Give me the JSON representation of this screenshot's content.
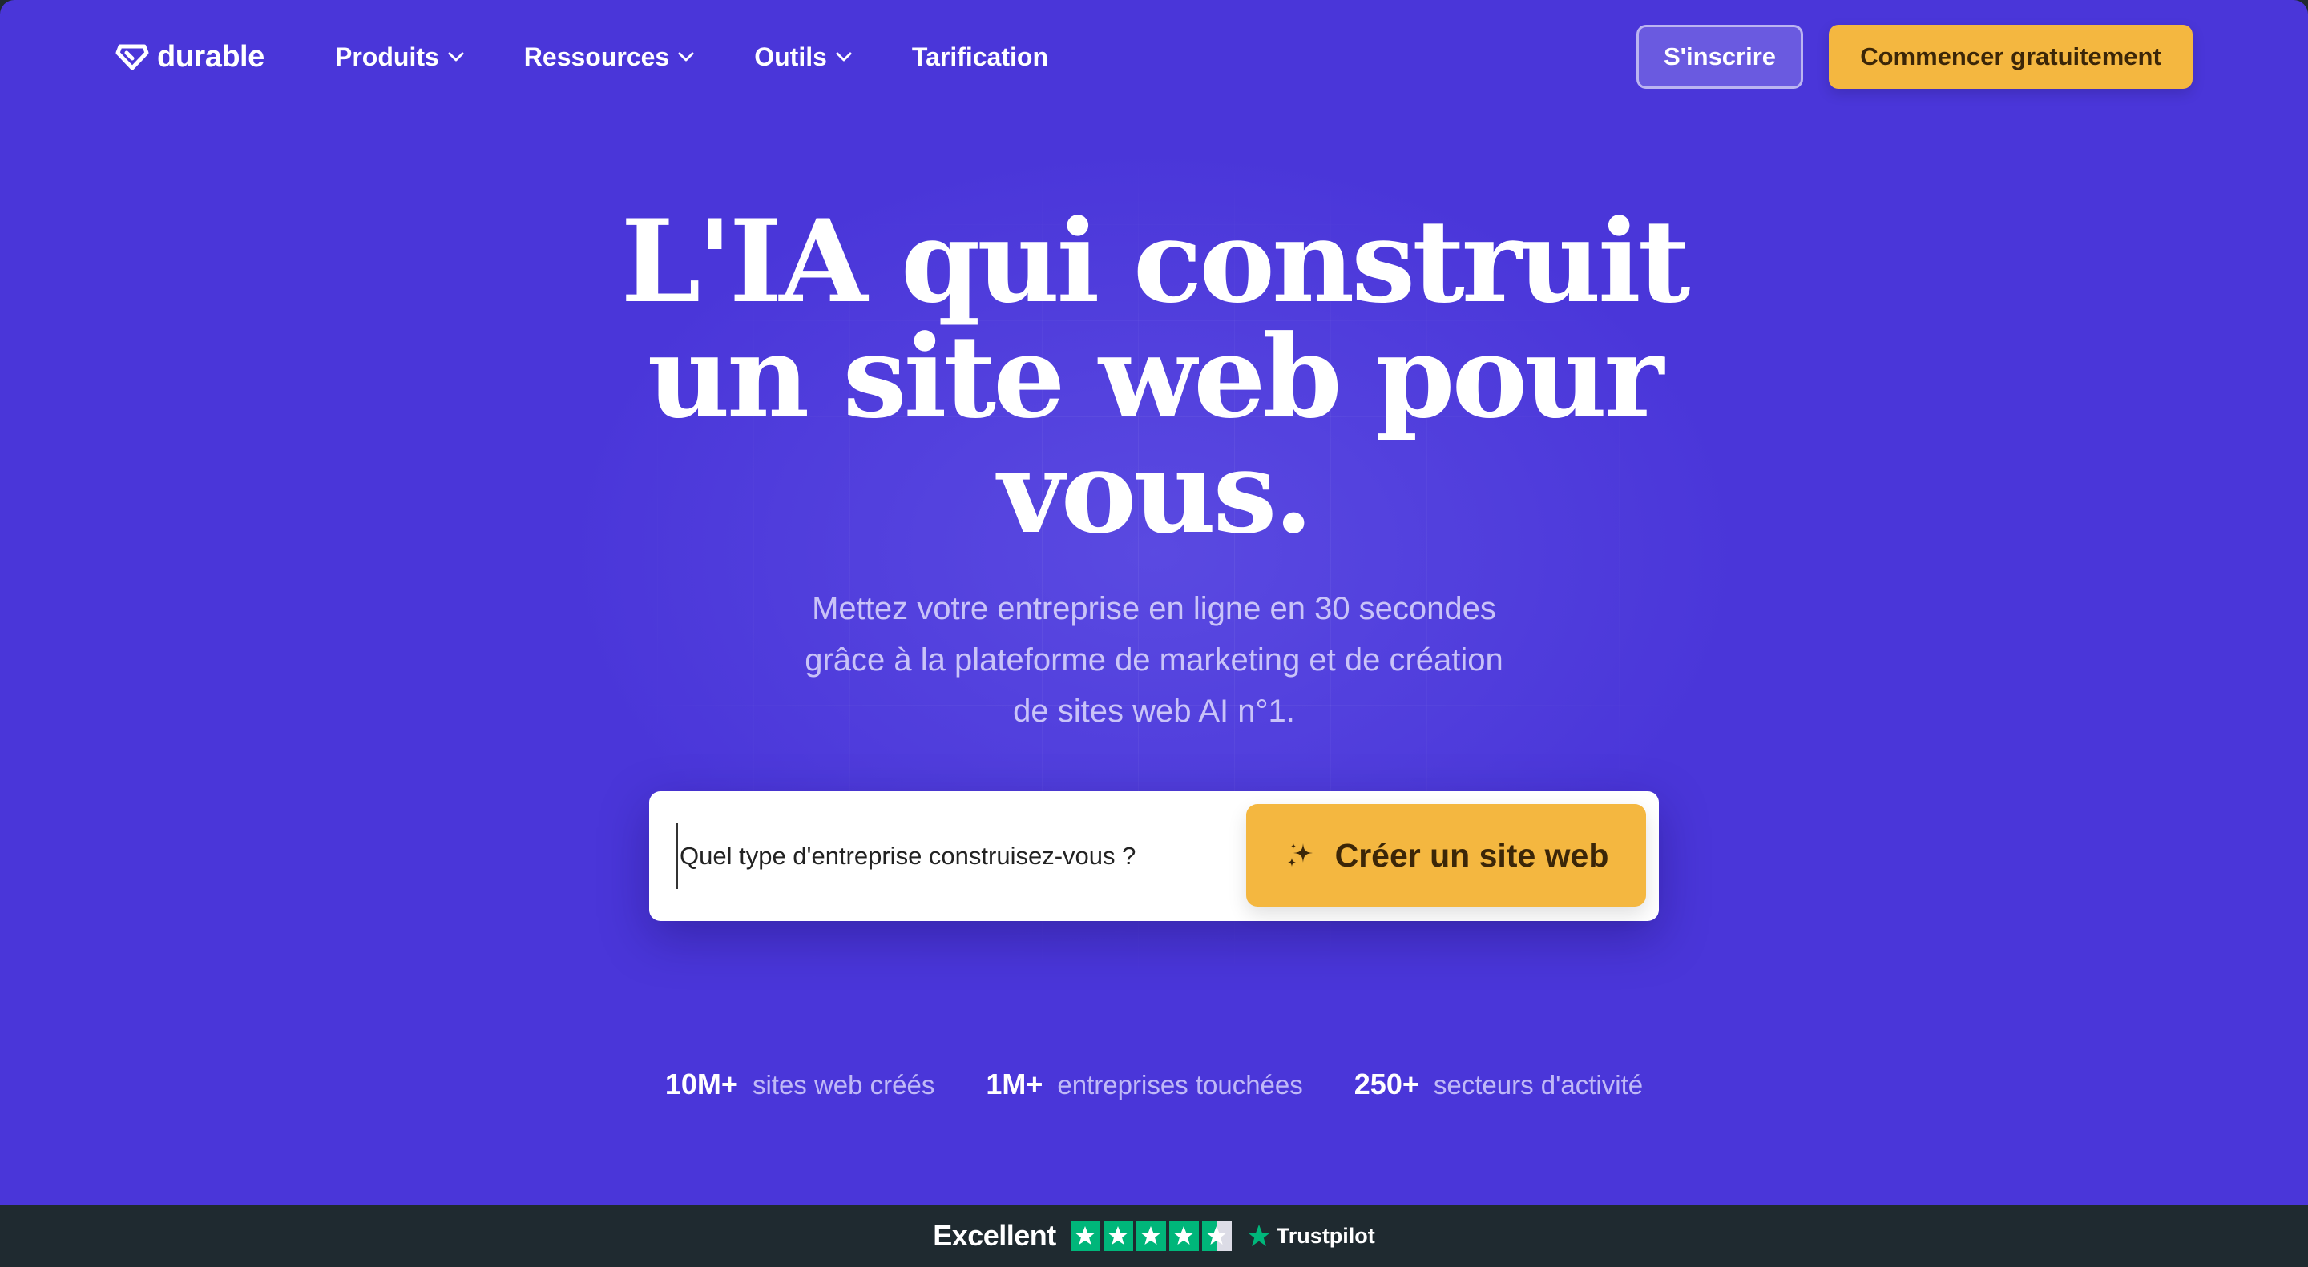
{
  "nav": {
    "logo_text": "durable",
    "items": [
      {
        "label": "Produits",
        "has_dropdown": true
      },
      {
        "label": "Ressources",
        "has_dropdown": true
      },
      {
        "label": "Outils",
        "has_dropdown": true
      },
      {
        "label": "Tarification",
        "has_dropdown": false
      }
    ],
    "signin_label": "S'inscrire",
    "start_label": "Commencer gratuitement"
  },
  "hero": {
    "headline_lines": [
      "L'IA qui construit",
      "un site web pour",
      "vous."
    ],
    "subtitle_lines": [
      "Mettez votre entreprise en ligne en 30 secondes",
      "grâce à la plateforme de marketing et de création",
      "de sites web AI n°1."
    ]
  },
  "search": {
    "placeholder": "Quel type d'entreprise construisez-vous ?",
    "value": "",
    "button_label": "Créer un site web",
    "button_icon": "sparkle-icon"
  },
  "stats": [
    {
      "number": "10M+",
      "label": "sites web créés"
    },
    {
      "number": "1M+",
      "label": "entreprises touchées"
    },
    {
      "number": "250+",
      "label": "secteurs d'activité"
    }
  ],
  "trustpilot": {
    "rating_word": "Excellent",
    "stars_filled": 4.5,
    "stars_total": 5,
    "brand": "Trustpilot"
  },
  "colors": {
    "hero_bg": "#4a36d9",
    "accent_yellow": "#f4b740",
    "footer_bar": "#1f2a30",
    "trustpilot_green": "#00b67a"
  }
}
